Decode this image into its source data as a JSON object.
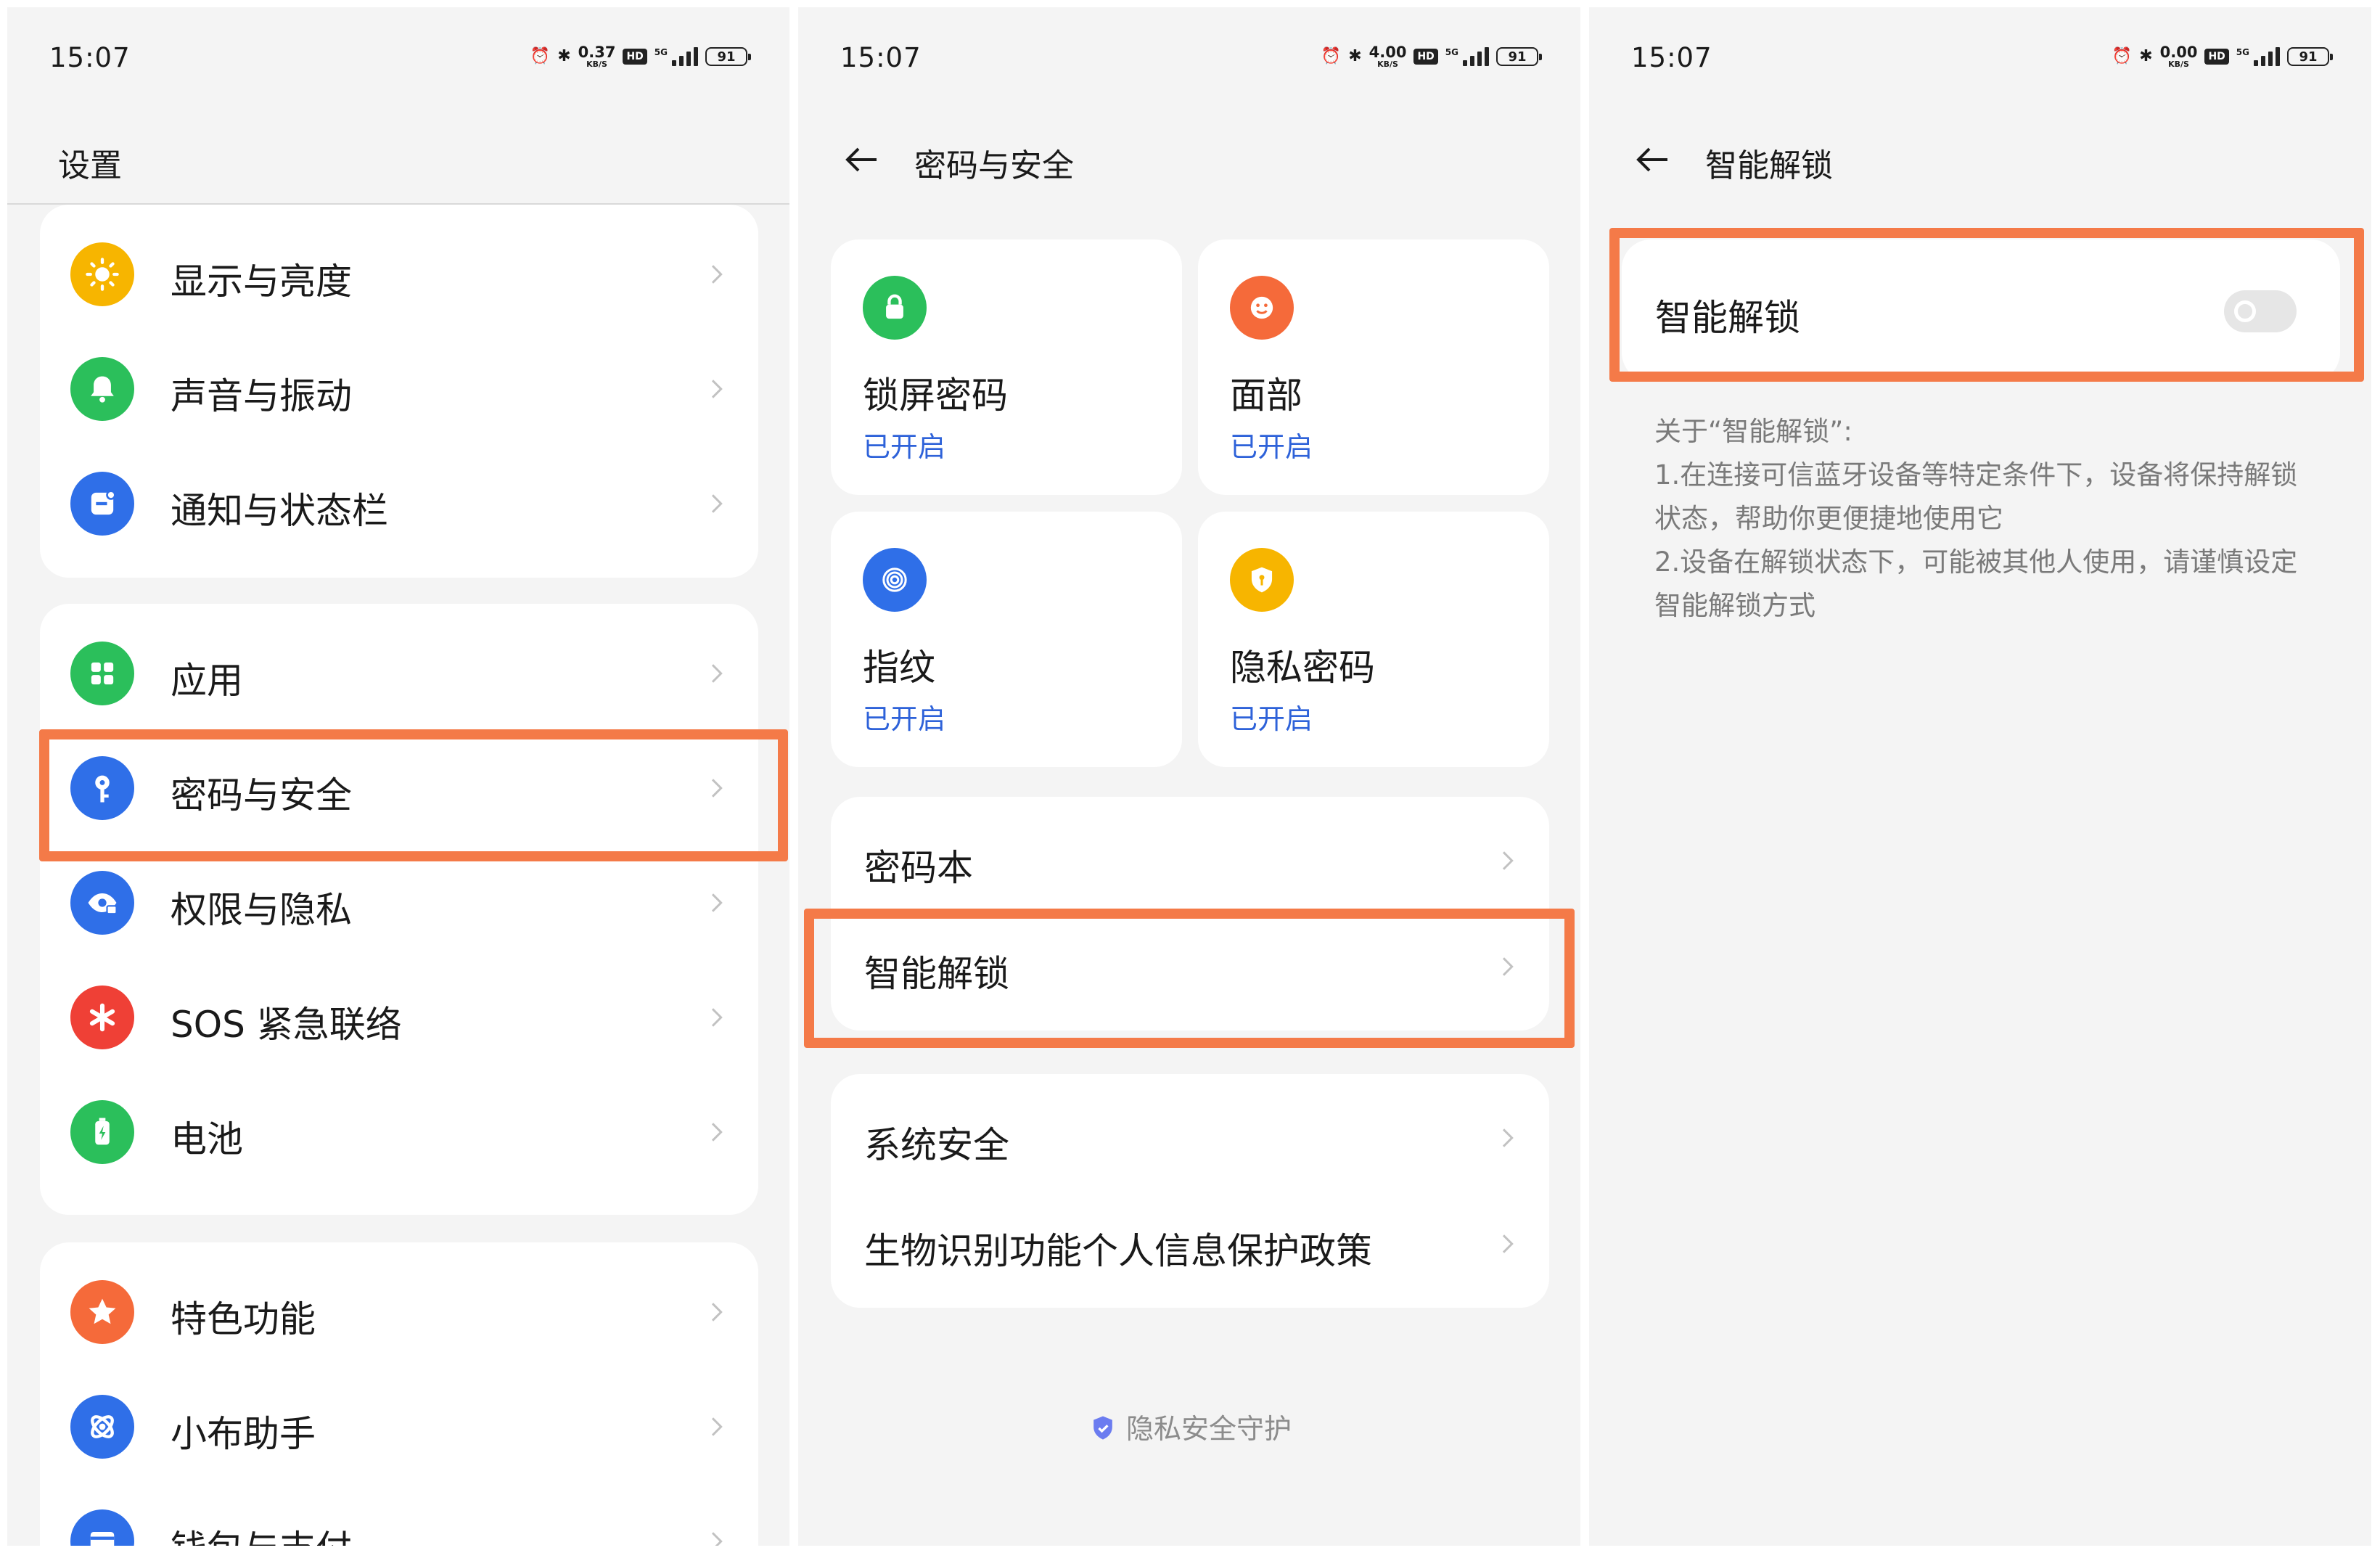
{
  "status_bars": [
    {
      "time": "15:07",
      "speed": "0.37",
      "speed_unit": "KB/S",
      "hd": "HD",
      "network": "5G",
      "battery": "91"
    },
    {
      "time": "15:07",
      "speed": "4.00",
      "speed_unit": "KB/S",
      "hd": "HD",
      "network": "5G",
      "battery": "91"
    },
    {
      "time": "15:07",
      "speed": "0.00",
      "speed_unit": "KB/S",
      "hd": "HD",
      "network": "5G",
      "battery": "91"
    }
  ],
  "settings": {
    "title": "设置",
    "group1": [
      {
        "label": "显示与亮度",
        "icon": "sun-icon",
        "color": "#f7b500"
      },
      {
        "label": "声音与振动",
        "icon": "bell-icon",
        "color": "#2bbf5b"
      },
      {
        "label": "通知与状态栏",
        "icon": "notification-icon",
        "color": "#2f6fe8"
      }
    ],
    "group2": [
      {
        "label": "应用",
        "icon": "apps-grid-icon",
        "color": "#2bbf5b"
      },
      {
        "label": "密码与安全",
        "icon": "key-icon",
        "color": "#2f6fe8"
      },
      {
        "label": "权限与隐私",
        "icon": "privacy-eye-icon",
        "color": "#2f6fe8"
      },
      {
        "label": "SOS 紧急联络",
        "icon": "sos-asterisk-icon",
        "color": "#ef4036"
      },
      {
        "label": "电池",
        "icon": "battery-icon",
        "color": "#2bbf5b"
      }
    ],
    "group3": [
      {
        "label": "特色功能",
        "icon": "star-icon",
        "color": "#f56a3a"
      },
      {
        "label": "小布助手",
        "icon": "assistant-icon",
        "color": "#2f6fe8"
      },
      {
        "label": "钱包与支付",
        "icon": "wallet-icon",
        "color": "#2f6fe8"
      }
    ]
  },
  "security": {
    "title": "密码与安全",
    "tiles": [
      {
        "title": "锁屏密码",
        "status": "已开启",
        "icon": "lock-icon",
        "color": "#2bbf5b"
      },
      {
        "title": "面部",
        "status": "已开启",
        "icon": "face-icon",
        "color": "#f56a3a"
      },
      {
        "title": "指纹",
        "status": "已开启",
        "icon": "fingerprint-icon",
        "color": "#2f6fe8"
      },
      {
        "title": "隐私密码",
        "status": "已开启",
        "icon": "privacy-shield-icon",
        "color": "#f7b500"
      }
    ],
    "list1": [
      "密码本",
      "智能解锁"
    ],
    "list2": [
      "系统安全",
      "生物识别功能个人信息保护政策"
    ],
    "footer": "隐私安全守护"
  },
  "smart_unlock": {
    "title": "智能解锁",
    "toggle_label": "智能解锁",
    "toggle_on": false,
    "description": [
      "关于“智能解锁”:",
      "1.在连接可信蓝牙设备等特定条件下，设备将保持解锁状态，帮助你更便捷地使用它",
      "2.设备在解锁状态下，可能被其他人使用，请谨慎设定智能解锁方式"
    ]
  },
  "colors": {
    "highlight": "#f47a48",
    "link_blue": "#2e62d9",
    "background": "#f4f4f4"
  }
}
